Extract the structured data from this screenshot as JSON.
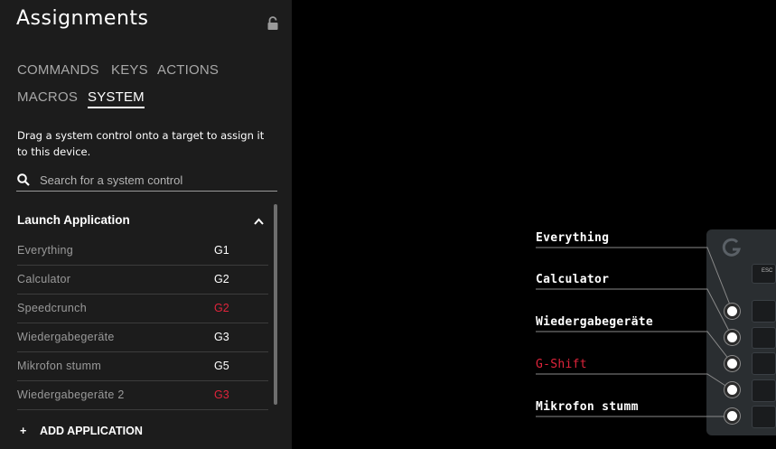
{
  "panel": {
    "title": "Assignments",
    "tabs": [
      "COMMANDS",
      "KEYS",
      "ACTIONS",
      "MACROS",
      "SYSTEM"
    ],
    "active_tab": "SYSTEM",
    "description": "Drag a system control onto a target to assign it to this device.",
    "search_placeholder": "Search for a system control",
    "section_title": "Launch Application",
    "items": [
      {
        "name": "Everything",
        "key": "G1",
        "key_color": "white"
      },
      {
        "name": "Calculator",
        "key": "G2",
        "key_color": "white"
      },
      {
        "name": "Speedcrunch",
        "key": "G2",
        "key_color": "red"
      },
      {
        "name": "Wiedergabegeräte",
        "key": "G3",
        "key_color": "white"
      },
      {
        "name": "Mikrofon stumm",
        "key": "G5",
        "key_color": "white"
      },
      {
        "name": "Wiedergabegeräte 2",
        "key": "G3",
        "key_color": "red"
      }
    ],
    "add_button": "ADD APPLICATION"
  },
  "callouts": [
    {
      "label": "Everything",
      "color": "white"
    },
    {
      "label": "Calculator",
      "color": "white"
    },
    {
      "label": "Wiedergabegeräte",
      "color": "white"
    },
    {
      "label": "G-Shift",
      "color": "red"
    },
    {
      "label": "Mikrofon stumm",
      "color": "white"
    }
  ],
  "keyboard": {
    "esc_label": "ESC"
  },
  "colors": {
    "panel_bg": "#1c1c1c",
    "accent_red": "#e0243b",
    "text_muted": "#9a9a9a"
  }
}
